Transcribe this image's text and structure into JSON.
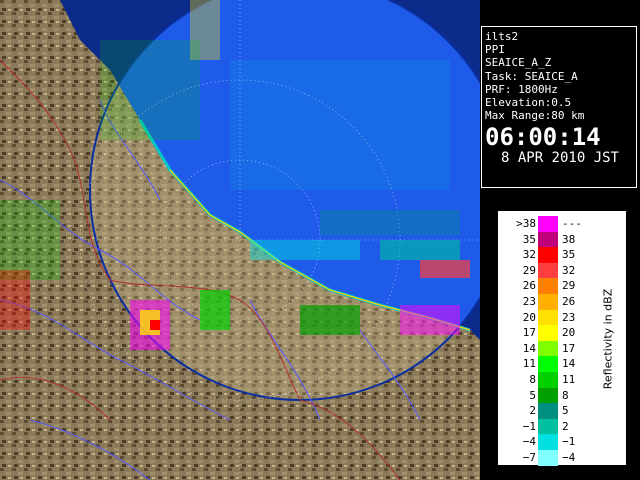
{
  "radar": {
    "station": "ilts2",
    "mode": "PPI",
    "volume": "SEAICE_A_Z",
    "task": "Task: SEAICE_A",
    "prf": "PRF: 1800Hz",
    "elevation": "Elevation:0.5",
    "max_range": "Max Range:80 km",
    "time": "06:00:14",
    "date": "8 APR 2010 JST"
  },
  "legend": {
    "axis_label": "Reflectivity in dBZ",
    "rows": [
      {
        "low": ">38",
        "high": "---",
        "color": "#ff00ff"
      },
      {
        "low": "35",
        "high": "38",
        "color": "#c0007a"
      },
      {
        "low": "32",
        "high": "35",
        "color": "#ff0000"
      },
      {
        "low": "29",
        "high": "32",
        "color": "#ff3f3f"
      },
      {
        "low": "26",
        "high": "29",
        "color": "#ff8000"
      },
      {
        "low": "23",
        "high": "26",
        "color": "#ffb000"
      },
      {
        "low": "20",
        "high": "23",
        "color": "#ffe000"
      },
      {
        "low": "17",
        "high": "20",
        "color": "#ffff00"
      },
      {
        "low": "14",
        "high": "17",
        "color": "#80ff00"
      },
      {
        "low": "11",
        "high": "14",
        "color": "#00ff00"
      },
      {
        "low": "8",
        "high": "11",
        "color": "#00d000"
      },
      {
        "low": "5",
        "high": "8",
        "color": "#00a000"
      },
      {
        "low": "2",
        "high": "5",
        "color": "#009080"
      },
      {
        "low": "−1",
        "high": "2",
        "color": "#00c0a0"
      },
      {
        "low": "−4",
        "high": "−1",
        "color": "#00e0e0"
      },
      {
        "low": "−7",
        "high": "−4",
        "color": "#80ffff"
      }
    ]
  },
  "colors": {
    "sea": "#1a4fd6",
    "land": "#8a7a5a",
    "range_ring": "#ffffff",
    "rivers": "#5a5aff",
    "borders": "#b03030"
  }
}
